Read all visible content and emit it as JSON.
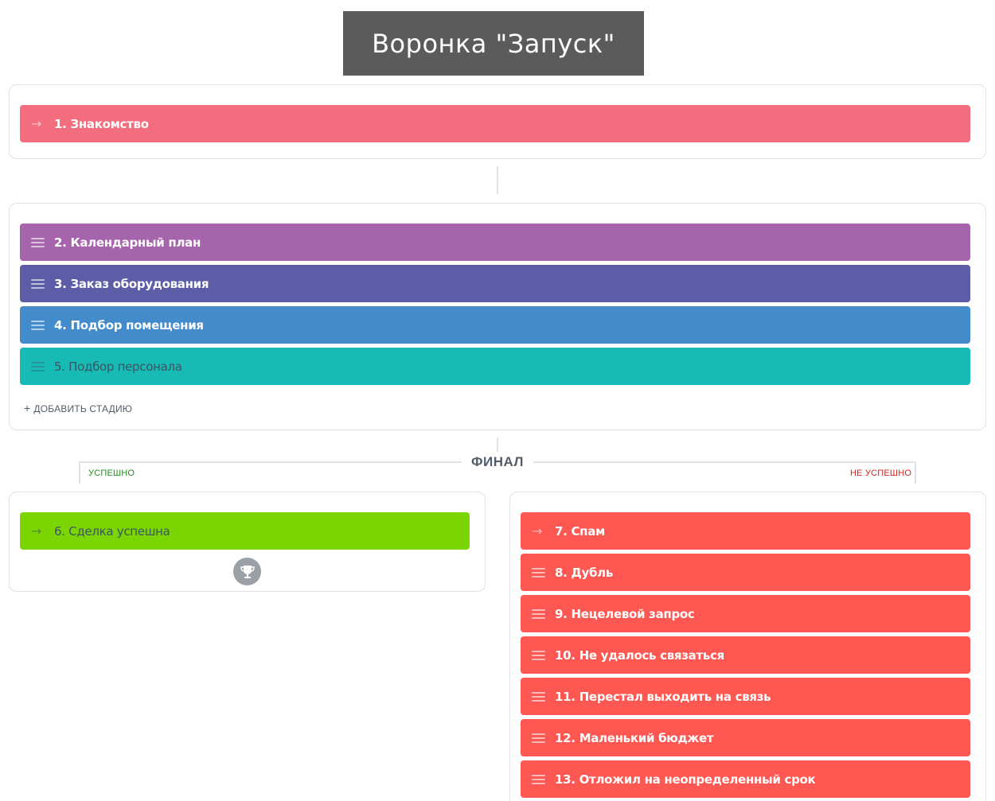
{
  "funnel": {
    "title": "Воронка \"Запуск\""
  },
  "colors": {
    "stage1": "#f26d7d",
    "stage2": "#a564ab",
    "stage3": "#5d5ca7",
    "stage4": "#448bcb",
    "stage5": "#17bab4",
    "success": "#7ad500",
    "fail": "#ff5752"
  },
  "start_stage": {
    "label": "1. Знакомство",
    "icon": "arrow-right-icon"
  },
  "process_stages": [
    {
      "label": "2. Календарный план",
      "icon": "drag-handle-icon"
    },
    {
      "label": "3. Заказ оборудования",
      "icon": "drag-handle-icon"
    },
    {
      "label": "4. Подбор помещения",
      "icon": "drag-handle-icon"
    },
    {
      "label": "5. Подбор персонала",
      "icon": "drag-handle-icon"
    }
  ],
  "add_stage": {
    "label": "ДОБАВИТЬ СТАДИЮ",
    "icon": "plus-icon"
  },
  "final": {
    "label": "ФИНАЛ",
    "success_label": "УСПЕШНО",
    "fail_label": "НЕ УСПЕШНО"
  },
  "success_stage": {
    "label": "6. Сделка успешна",
    "icon": "arrow-right-icon",
    "badge_icon": "trophy-icon"
  },
  "fail_stages": [
    {
      "label": "7. Спам",
      "icon": "arrow-right-icon"
    },
    {
      "label": "8. Дубль",
      "icon": "drag-handle-icon"
    },
    {
      "label": "9. Нецелевой запрос",
      "icon": "drag-handle-icon"
    },
    {
      "label": "10. Не удалось связаться",
      "icon": "drag-handle-icon"
    },
    {
      "label": "11. Перестал выходить на связь",
      "icon": "drag-handle-icon"
    },
    {
      "label": "12. Маленький бюджет",
      "icon": "drag-handle-icon"
    },
    {
      "label": "13. Отложил на неопределенный срок",
      "icon": "drag-handle-icon"
    }
  ]
}
